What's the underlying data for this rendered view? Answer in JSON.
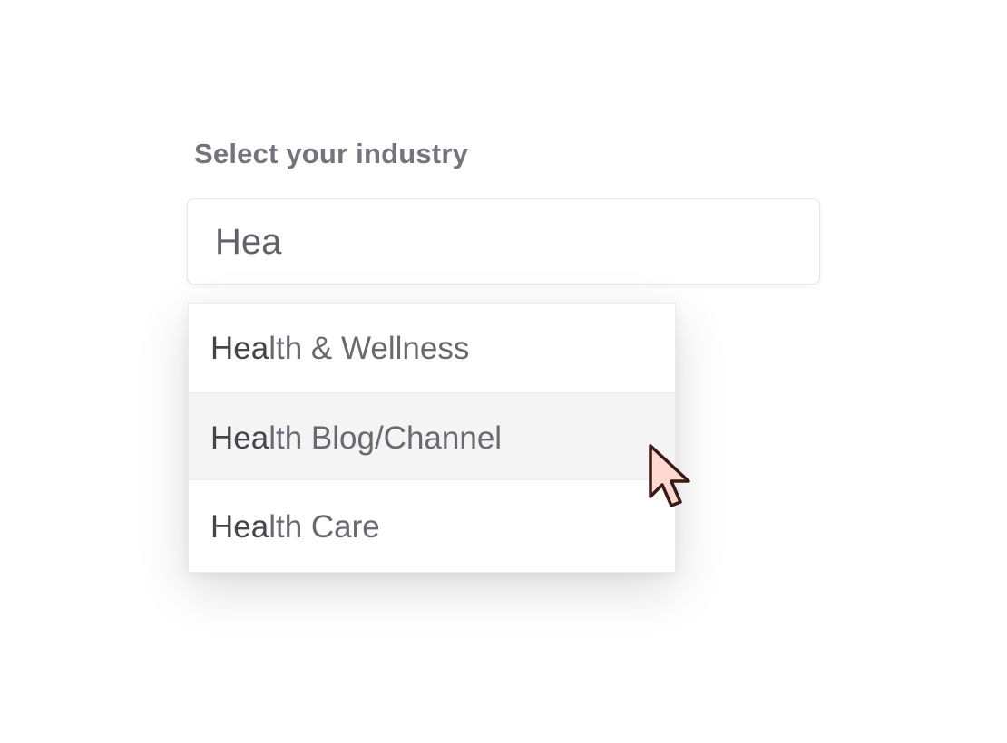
{
  "form": {
    "label": "Select your industry",
    "input": {
      "value": "Hea"
    }
  },
  "dropdown": {
    "highlighted_index": 1,
    "options": [
      {
        "match": "Hea",
        "rest": "lth & Wellness"
      },
      {
        "match": "Hea",
        "rest": "lth Blog/Channel"
      },
      {
        "match": "Hea",
        "rest": "lth Care"
      }
    ]
  },
  "cursor": {
    "icon": "pointer-cursor-icon",
    "fill": "#ffd9cf",
    "stroke": "#3a1a14"
  },
  "colors": {
    "label": "#76737d",
    "input_text": "#626068",
    "option_text": "#6b6970",
    "option_match": "#46444b",
    "highlight_bg": "#f4f4f5"
  }
}
